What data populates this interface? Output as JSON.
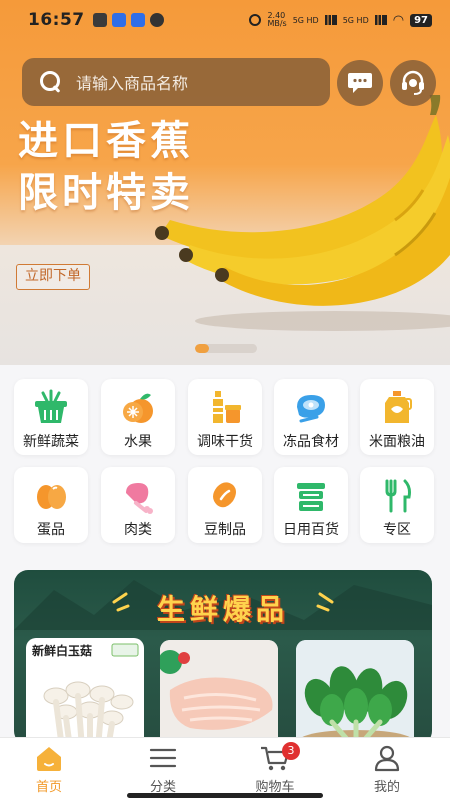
{
  "status_bar": {
    "time": "16:57",
    "network_speed": "2.40",
    "network_unit": "MB/s",
    "signal_1": "5G HD",
    "signal_2": "5G HD",
    "battery": "97"
  },
  "search": {
    "placeholder": "请输入商品名称"
  },
  "banner": {
    "headline_line1": "进口香蕉",
    "headline_line2": "限时特卖",
    "cta_label": "立即下单"
  },
  "categories": [
    {
      "label": "新鲜蔬菜",
      "icon": "basket-icon",
      "color": "#2fb86a"
    },
    {
      "label": "水果",
      "icon": "orange-icon",
      "color": "#f5962c"
    },
    {
      "label": "调味干货",
      "icon": "condiment-icon",
      "color": "#f2b62e"
    },
    {
      "label": "冻品食材",
      "icon": "meat-icon",
      "color": "#3aa0e8"
    },
    {
      "label": "米面粮油",
      "icon": "oil-icon",
      "color": "#f2b62e"
    },
    {
      "label": "蛋品",
      "icon": "egg-icon",
      "color": "#f5962c"
    },
    {
      "label": "肉类",
      "icon": "drumstick-icon",
      "color": "#f07aa0"
    },
    {
      "label": "豆制品",
      "icon": "bean-icon",
      "color": "#f5962c"
    },
    {
      "label": "日用百货",
      "icon": "container-icon",
      "color": "#2fb86a"
    },
    {
      "label": "专区",
      "icon": "utensils-icon",
      "color": "#2fb86a"
    }
  ],
  "promo": {
    "title": "生鲜爆品",
    "cards": [
      {
        "label": "新鲜白玉菇"
      },
      {
        "label": ""
      },
      {
        "label": ""
      }
    ]
  },
  "tabbar": {
    "tabs": [
      {
        "label": "首页",
        "icon": "home-icon"
      },
      {
        "label": "分类",
        "icon": "menu-icon"
      },
      {
        "label": "购物车",
        "icon": "cart-icon"
      },
      {
        "label": "我的",
        "icon": "user-icon"
      }
    ],
    "cart_badge": "3",
    "accent": "#f29a2a"
  }
}
